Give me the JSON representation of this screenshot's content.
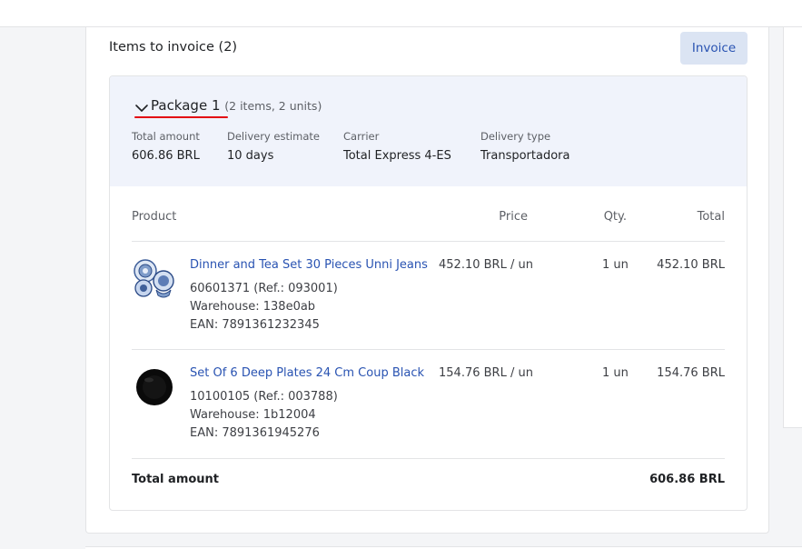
{
  "card": {
    "title": "Items to invoice (2)",
    "invoice_button": "Invoice"
  },
  "package": {
    "title": "Package 1",
    "count": "(2 items, 2 units)",
    "meta": [
      {
        "label": "Total amount",
        "value": "606.86 BRL"
      },
      {
        "label": "Delivery estimate",
        "value": "10 days"
      },
      {
        "label": "Carrier",
        "value": "Total Express 4-ES"
      },
      {
        "label": "Delivery type",
        "value": "Transportadora"
      }
    ],
    "columns": {
      "product": "Product",
      "price": "Price",
      "qty": "Qty.",
      "total": "Total"
    },
    "items": [
      {
        "name": "Dinner and Tea Set 30 Pieces Unni Jeans",
        "sku": "60601371 (Ref.: 093001)",
        "warehouse": "Warehouse: 138e0ab",
        "ean": "EAN: 7891361232345",
        "price": "452.10 BRL / un",
        "qty": "1 un",
        "total": "452.10 BRL",
        "thumb_icon": "blue-porcelain-set-icon"
      },
      {
        "name": "Set Of 6 Deep Plates 24 Cm Coup Black",
        "sku": "10100105 (Ref.: 003788)",
        "warehouse": "Warehouse: 1b12004",
        "ean": "EAN: 7891361945276",
        "price": "154.76 BRL / un",
        "qty": "1 un",
        "total": "154.76 BRL",
        "thumb_icon": "black-plate-icon"
      }
    ],
    "total_label": "Total amount",
    "total_value": "606.86 BRL"
  },
  "colors": {
    "accent": "#2953b2",
    "button_bg": "#dbe4f3",
    "package_header_bg": "#f0f3fb",
    "underline": "#e30613"
  }
}
